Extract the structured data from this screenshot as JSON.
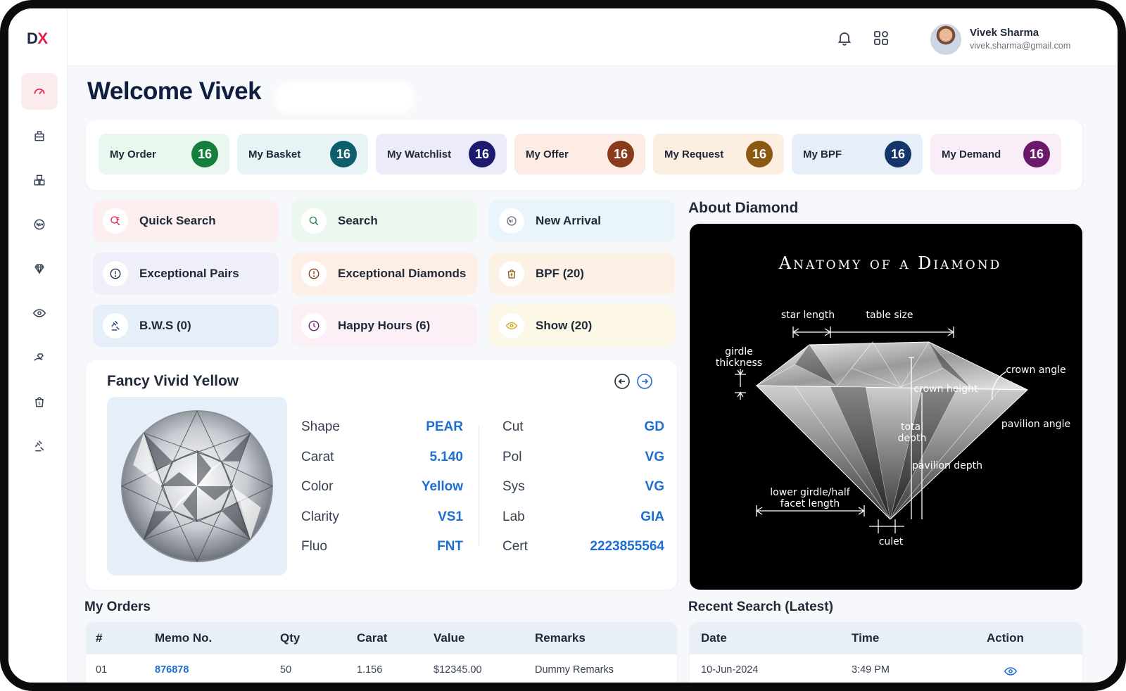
{
  "brand": {
    "logo_d": "D",
    "logo_x": "X"
  },
  "sidebar": {
    "items": [
      {
        "icon": "dashboard-icon",
        "active": true
      },
      {
        "icon": "cart-icon",
        "active": false
      },
      {
        "icon": "inventory-icon",
        "active": false
      },
      {
        "icon": "new-badge-icon",
        "active": false
      },
      {
        "icon": "diamond-icon",
        "active": false
      },
      {
        "icon": "eye-icon",
        "active": false
      },
      {
        "icon": "hand-diamond-icon",
        "active": false
      },
      {
        "icon": "bpf-bag-icon",
        "active": false
      },
      {
        "icon": "auction-icon",
        "active": false
      }
    ]
  },
  "header": {
    "user_name": "Vivek Sharma",
    "user_email": "vivek.sharma@gmail.com"
  },
  "welcome": {
    "title": "Welcome Vivek"
  },
  "stats": [
    {
      "label": "My Order",
      "count": "16",
      "bg": "#e9f7ee",
      "badge": "#15803d"
    },
    {
      "label": "My Basket",
      "count": "16",
      "bg": "#e6f4f6",
      "badge": "#0f5e6b"
    },
    {
      "label": "My Watchlist",
      "count": "16",
      "bg": "#ecebfa",
      "badge": "#1e1b6e"
    },
    {
      "label": "My Offer",
      "count": "16",
      "bg": "#fdece4",
      "badge": "#8a3b1c"
    },
    {
      "label": "My Request",
      "count": "16",
      "bg": "#fcefe2",
      "badge": "#8a5a12"
    },
    {
      "label": "My BPF",
      "count": "16",
      "bg": "#e6eef9",
      "badge": "#14366b"
    },
    {
      "label": "My Demand",
      "count": "16",
      "bg": "#f9eef7",
      "badge": "#6b1a6b"
    }
  ],
  "quick_actions": [
    {
      "label": "Quick Search",
      "icon": "quick-search-icon",
      "bg": "#fdeef0",
      "color": "#e11d48"
    },
    {
      "label": "Search",
      "icon": "search-icon",
      "bg": "#ecf8ef",
      "color": "#15803d"
    },
    {
      "label": "New Arrival",
      "icon": "new-badge-icon",
      "bg": "#e9f5fa",
      "color": "#6b7280"
    },
    {
      "label": "Exceptional Pairs",
      "icon": "info-icon",
      "bg": "#eeeff8",
      "color": "#1e2a4a"
    },
    {
      "label": "Exceptional Diamonds",
      "icon": "info-icon",
      "bg": "#fdeee6",
      "color": "#8a3b1c"
    },
    {
      "label": "BPF (20)",
      "icon": "bpf-bag-icon",
      "bg": "#fdf0e4",
      "color": "#8a5a12"
    },
    {
      "label": "B.W.S (0)",
      "icon": "auction-icon",
      "bg": "#e6eef9",
      "color": "#14366b"
    },
    {
      "label": "Happy Hours (6)",
      "icon": "clock-icon",
      "bg": "#faf0f6",
      "color": "#6b1a6b"
    },
    {
      "label": "Show (20)",
      "icon": "eye-icon",
      "bg": "#fdf8e6",
      "color": "#d4a514"
    }
  ],
  "fancy": {
    "title": "Fancy Vivid Yellow",
    "left_specs": [
      {
        "key": "Shape",
        "value": "PEAR"
      },
      {
        "key": "Carat",
        "value": "5.140"
      },
      {
        "key": "Color",
        "value": "Yellow"
      },
      {
        "key": "Clarity",
        "value": "VS1"
      },
      {
        "key": "Fluo",
        "value": "FNT"
      }
    ],
    "right_specs": [
      {
        "key": "Cut",
        "value": "GD"
      },
      {
        "key": "Pol",
        "value": "VG"
      },
      {
        "key": "Sys",
        "value": "VG"
      },
      {
        "key": "Lab",
        "value": "GIA"
      },
      {
        "key": "Cert",
        "value": "2223855564"
      }
    ]
  },
  "about": {
    "title": "About Diamond",
    "diagram_title": "Anatomy of a Diamond",
    "labels": {
      "star_length": "star length",
      "table_size": "table size",
      "girdle_1": "girdle",
      "girdle_2": "thickness",
      "crown_angle": "crown angle",
      "crown_height": "crown height",
      "total_1": "total",
      "total_2": "depth",
      "pavilion_angle": "pavilion angle",
      "pavilion_depth": "pavilion depth",
      "lower_1": "lower girdle/half",
      "lower_2": "facet length",
      "culet": "culet"
    }
  },
  "orders": {
    "title": "My Orders",
    "columns": [
      "#",
      "Memo No.",
      "Qty",
      "Carat",
      "Value",
      "Remarks"
    ],
    "rows": [
      {
        "num": "01",
        "memo": "876878",
        "qty": "50",
        "carat": "1.156",
        "value": "$12345.00",
        "remarks": "Dummy Remarks"
      }
    ]
  },
  "recent": {
    "title": "Recent Search (Latest)",
    "columns": [
      "Date",
      "Time",
      "Action"
    ],
    "rows": [
      {
        "date": "10-Jun-2024",
        "time": "3:49 PM",
        "action_icon": "eye-icon"
      }
    ]
  }
}
